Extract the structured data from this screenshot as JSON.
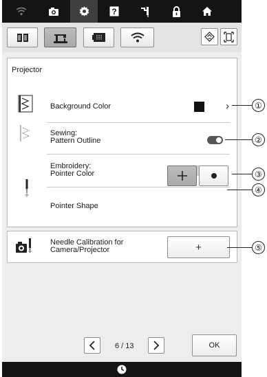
{
  "top_bar": {
    "icons": [
      "wifi-icon",
      "camera-icon",
      "gear-icon",
      "help-icon",
      "needle-threading-icon",
      "lock-icon",
      "home-icon"
    ],
    "active": "gear-icon"
  },
  "tabs": {
    "icons": [
      "book-icon",
      "sewing-machine-icon",
      "embroidery-icon",
      "wifi-icon"
    ],
    "active": "sewing-machine-icon",
    "right_icons": [
      "projector-pattern-icon",
      "frame-icon"
    ]
  },
  "projector": {
    "title": "Projector",
    "background_color": {
      "label": "Background Color",
      "value_color": "#111111"
    },
    "sewing_outline": {
      "label_line1": "Sewing:",
      "label_line2": "Pattern Outline",
      "toggle_state": "on"
    },
    "embroidery_pointer": {
      "label_line1": "Embroidery:",
      "label_line2": "Pointer Color",
      "value_color": "#d0d0d0"
    },
    "pointer_shape": {
      "label": "Pointer Shape",
      "options": [
        "cross",
        "dot"
      ],
      "selected": "cross"
    }
  },
  "calibration": {
    "label_line1": "Needle Calibration for",
    "label_line2": "Camera/Projector",
    "button_label": "+"
  },
  "pagination": {
    "text": "6 / 13"
  },
  "ok_label": "OK",
  "callouts": [
    "①",
    "②",
    "③",
    "④",
    "⑤"
  ]
}
